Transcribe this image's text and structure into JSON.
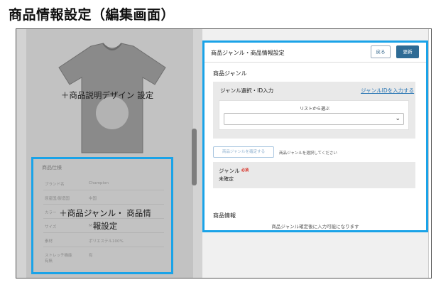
{
  "page_title": "商品情報設定（編集画面）",
  "overlays": {
    "design": "＋商品説明デザイン 設定",
    "specs": "＋商品ジャンル・ 商品情報設定"
  },
  "preview": {
    "spec_title": "商品仕様",
    "rows": [
      {
        "label": "ブランド名",
        "value": "Champion"
      },
      {
        "label": "原産国/製造国",
        "value": "中国"
      },
      {
        "label": "カラー",
        "value": "グレー"
      },
      {
        "label": "サイズ",
        "value": "M"
      },
      {
        "label": "素材",
        "value": "ポリエステル100%"
      },
      {
        "label": "ストレッチ機能有無",
        "value": "有"
      }
    ]
  },
  "panel": {
    "title": "商品ジャンル・商品情報設定",
    "back_label": "戻る",
    "update_label": "更新",
    "genre_section": "商品ジャンル",
    "genre_select_label": "ジャンル選択・ID入力",
    "genre_id_link": "ジャンルIDを入力する",
    "list_label": "リストから選ぶ",
    "select_value": "",
    "confirm_button": "商品ジャンルを確定する",
    "confirm_hint": "商品ジャンルを選択してください",
    "genre_label": "ジャンル",
    "required_badge": "必須",
    "genre_value": "未確定",
    "info_section": "商品情報",
    "info_note": "商品ジャンル確定後に入力可能になります"
  },
  "colors": {
    "highlight": "#1aa3e8",
    "primary_button": "#2e6b95",
    "link": "#2b77b5",
    "required": "#d7281e"
  }
}
